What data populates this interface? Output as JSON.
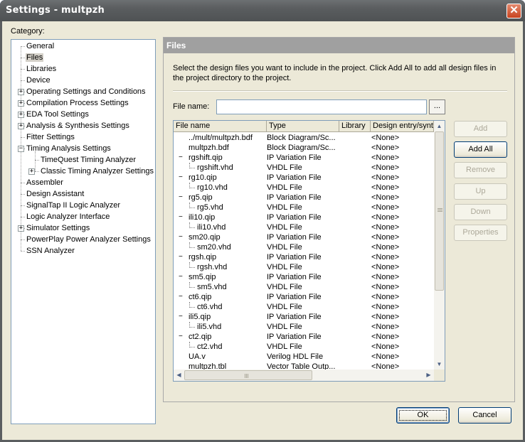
{
  "window": {
    "title": "Settings - multpzh",
    "close_glyph": "✕"
  },
  "category": {
    "label": "Category:",
    "items": [
      {
        "label": "General",
        "level": 0,
        "expander": ""
      },
      {
        "label": "Files",
        "level": 0,
        "expander": "",
        "selected": true
      },
      {
        "label": "Libraries",
        "level": 0,
        "expander": ""
      },
      {
        "label": "Device",
        "level": 0,
        "expander": ""
      },
      {
        "label": "Operating Settings and Conditions",
        "level": 0,
        "expander": "+"
      },
      {
        "label": "Compilation Process Settings",
        "level": 0,
        "expander": "+"
      },
      {
        "label": "EDA Tool Settings",
        "level": 0,
        "expander": "+"
      },
      {
        "label": "Analysis & Synthesis Settings",
        "level": 0,
        "expander": "+"
      },
      {
        "label": "Fitter Settings",
        "level": 0,
        "expander": ""
      },
      {
        "label": "Timing Analysis Settings",
        "level": 0,
        "expander": "−"
      },
      {
        "label": "TimeQuest Timing Analyzer",
        "level": 1,
        "expander": ""
      },
      {
        "label": "Classic Timing Analyzer Settings",
        "level": 1,
        "expander": "+"
      },
      {
        "label": "Assembler",
        "level": 0,
        "expander": ""
      },
      {
        "label": "Design Assistant",
        "level": 0,
        "expander": ""
      },
      {
        "label": "SignalTap II Logic Analyzer",
        "level": 0,
        "expander": ""
      },
      {
        "label": "Logic Analyzer Interface",
        "level": 0,
        "expander": ""
      },
      {
        "label": "Simulator Settings",
        "level": 0,
        "expander": "+"
      },
      {
        "label": "PowerPlay Power Analyzer Settings",
        "level": 0,
        "expander": ""
      },
      {
        "label": "SSN Analyzer",
        "level": 0,
        "expander": ""
      }
    ]
  },
  "panel": {
    "header": "Files",
    "description": "Select the design files you want to include in the project. Click Add All to add all design files in the project directory to the project.",
    "file_name_label": "File name:",
    "file_name_value": "",
    "browse_label": "...",
    "columns": [
      "File name",
      "Type",
      "Library",
      "Design entry/synth"
    ],
    "files": [
      {
        "name": "../mult/multpzh.bdf",
        "type": "Block Diagram/Sc...",
        "library": "",
        "entry": "<None>",
        "indent": 1,
        "expander": ""
      },
      {
        "name": "multpzh.bdf",
        "type": "Block Diagram/Sc...",
        "library": "",
        "entry": "<None>",
        "indent": 1,
        "expander": ""
      },
      {
        "name": "rgshift.qip",
        "type": "IP Variation File",
        "library": "",
        "entry": "<None>",
        "indent": 1,
        "expander": "−"
      },
      {
        "name": "rgshift.vhd",
        "type": "VHDL File",
        "library": "",
        "entry": "<None>",
        "indent": 2,
        "expander": ""
      },
      {
        "name": "rg10.qip",
        "type": "IP Variation File",
        "library": "",
        "entry": "<None>",
        "indent": 1,
        "expander": "−"
      },
      {
        "name": "rg10.vhd",
        "type": "VHDL File",
        "library": "",
        "entry": "<None>",
        "indent": 2,
        "expander": ""
      },
      {
        "name": "rg5.qip",
        "type": "IP Variation File",
        "library": "",
        "entry": "<None>",
        "indent": 1,
        "expander": "−"
      },
      {
        "name": "rg5.vhd",
        "type": "VHDL File",
        "library": "",
        "entry": "<None>",
        "indent": 2,
        "expander": ""
      },
      {
        "name": "ili10.qip",
        "type": "IP Variation File",
        "library": "",
        "entry": "<None>",
        "indent": 1,
        "expander": "−"
      },
      {
        "name": "ili10.vhd",
        "type": "VHDL File",
        "library": "",
        "entry": "<None>",
        "indent": 2,
        "expander": ""
      },
      {
        "name": "sm20.qip",
        "type": "IP Variation File",
        "library": "",
        "entry": "<None>",
        "indent": 1,
        "expander": "−"
      },
      {
        "name": "sm20.vhd",
        "type": "VHDL File",
        "library": "",
        "entry": "<None>",
        "indent": 2,
        "expander": ""
      },
      {
        "name": "rgsh.qip",
        "type": "IP Variation File",
        "library": "",
        "entry": "<None>",
        "indent": 1,
        "expander": "−"
      },
      {
        "name": "rgsh.vhd",
        "type": "VHDL File",
        "library": "",
        "entry": "<None>",
        "indent": 2,
        "expander": ""
      },
      {
        "name": "sm5.qip",
        "type": "IP Variation File",
        "library": "",
        "entry": "<None>",
        "indent": 1,
        "expander": "−"
      },
      {
        "name": "sm5.vhd",
        "type": "VHDL File",
        "library": "",
        "entry": "<None>",
        "indent": 2,
        "expander": ""
      },
      {
        "name": "ct6.qip",
        "type": "IP Variation File",
        "library": "",
        "entry": "<None>",
        "indent": 1,
        "expander": "−"
      },
      {
        "name": "ct6.vhd",
        "type": "VHDL File",
        "library": "",
        "entry": "<None>",
        "indent": 2,
        "expander": ""
      },
      {
        "name": "ili5.qip",
        "type": "IP Variation File",
        "library": "",
        "entry": "<None>",
        "indent": 1,
        "expander": "−"
      },
      {
        "name": "ili5.vhd",
        "type": "VHDL File",
        "library": "",
        "entry": "<None>",
        "indent": 2,
        "expander": ""
      },
      {
        "name": "ct2.qip",
        "type": "IP Variation File",
        "library": "",
        "entry": "<None>",
        "indent": 1,
        "expander": "−"
      },
      {
        "name": "ct2.vhd",
        "type": "VHDL File",
        "library": "",
        "entry": "<None>",
        "indent": 2,
        "expander": ""
      },
      {
        "name": "UA.v",
        "type": "Verilog HDL File",
        "library": "",
        "entry": "<None>",
        "indent": 1,
        "expander": ""
      },
      {
        "name": "multpzh.tbl",
        "type": "Vector Table Outp...",
        "library": "",
        "entry": "<None>",
        "indent": 1,
        "expander": ""
      }
    ],
    "buttons": [
      {
        "name": "add-button",
        "label": "Add",
        "enabled": false
      },
      {
        "name": "add-all-button",
        "label": "Add All",
        "enabled": true
      },
      {
        "name": "remove-button",
        "label": "Remove",
        "enabled": false
      },
      {
        "name": "up-button",
        "label": "Up",
        "enabled": false
      },
      {
        "name": "down-button",
        "label": "Down",
        "enabled": false
      },
      {
        "name": "properties-button",
        "label": "Properties",
        "enabled": false
      }
    ]
  },
  "footer": {
    "ok_label": "OK",
    "cancel_label": "Cancel"
  },
  "colors": {
    "panel_header": "#a0a0a0",
    "title_bar": "#5a5d5f",
    "dialog_bg": "#ece9d8",
    "focus_border": "#7da2ce"
  }
}
